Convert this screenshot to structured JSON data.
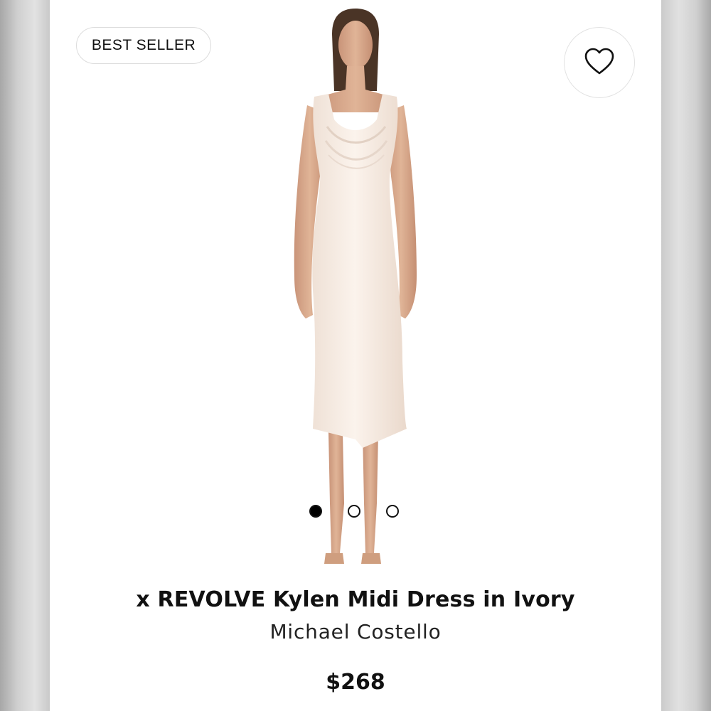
{
  "badge": {
    "label": "BEST SELLER"
  },
  "wishlist": {
    "icon": "heart-icon"
  },
  "product": {
    "title": "x REVOLVE Kylen Midi Dress in Ivory",
    "brand": "Michael Costello",
    "price": "$268",
    "image": "model-wearing-ivory-midi-dress"
  },
  "carousel": {
    "total": 3,
    "active_index": 0
  },
  "colors": {
    "dress": "#f6ebe2",
    "skin": "#d9a98a",
    "text": "#111111"
  }
}
